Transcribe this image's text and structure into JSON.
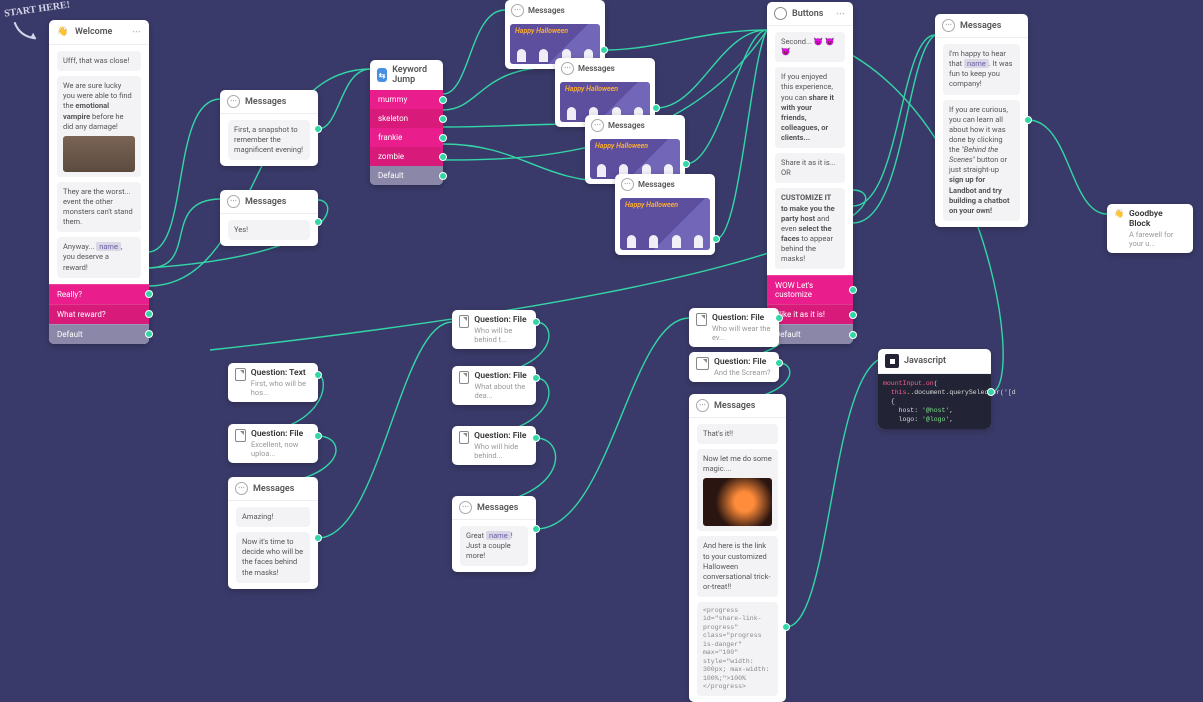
{
  "start_label": "START HERE!",
  "welcome": {
    "title": "Welcome",
    "msg1": "Ufff, that was close!",
    "msg2_head": "We are sure lucky you were able to find the ",
    "msg2_bold": "emotional vampire",
    "msg2_tail": " before he did any damage!",
    "msg3": "They are the worst... event the other monsters can't stand them.",
    "msg4_head": "Anyway... ",
    "msg4_var": "name",
    "msg4_tail": ", you deserve a reward!",
    "btn1": "Really?",
    "btn2": "What reward?",
    "default": "Default"
  },
  "msg_a": {
    "title": "Messages",
    "text": "First, a snapshot to remember the magnificent evening!"
  },
  "msg_b": {
    "title": "Messages",
    "text": "Yes!"
  },
  "keyword_jump": {
    "title": "Keyword Jump",
    "rows": [
      "mummy",
      "skeleton",
      "frankie",
      "zombie",
      "Default"
    ]
  },
  "halloween_banner": "Happy Halloween",
  "msg_h1": {
    "title": "Messages"
  },
  "msg_h2": {
    "title": "Messages"
  },
  "msg_h3": {
    "title": "Messages"
  },
  "msg_h4": {
    "title": "Messages"
  },
  "buttons": {
    "title": "Buttons",
    "line1": "Second...  😈  😈  😈",
    "line2_a": "If you enjoyed this experience, you can ",
    "line2_b": "share it with your friends, colleagues, or clients...",
    "line3": "Share it as it is... OR",
    "line4_a": "CUSTOMIZE IT to make you the party host",
    "line4_b": " and even ",
    "line4_c": "select the faces",
    "line4_d": " to appear behind the masks!",
    "btn1": "WOW Let's customize",
    "btn2": "I like it as it is!",
    "default": "Default"
  },
  "msg_right": {
    "title": "Messages",
    "p1_a": "I'm happy to hear that ",
    "p1_var": "name",
    "p1_b": ". It was fun to keep you company!",
    "p2_a": "If you are curious, you can learn all about how it was done by clicking the ",
    "p2_i": "\"Behind the Scenes\"",
    "p2_b": " button or just straight-up ",
    "p2_bold": "sign up for Landbot and try building a chatbot on your own!"
  },
  "goodbye": {
    "title": "Goodbye Block",
    "subtitle": "A farewell for your u..."
  },
  "q_text": {
    "title": "Question: Text",
    "subtitle": "First, who will be hos..."
  },
  "q_file1": {
    "title": "Question: File",
    "subtitle": "Excellent, now uploa..."
  },
  "q_file2": {
    "title": "Question: File",
    "subtitle": "Who will be behind t..."
  },
  "q_file3": {
    "title": "Question: File",
    "subtitle": "What about the dea..."
  },
  "q_file4": {
    "title": "Question: File",
    "subtitle": "Who will hide behind..."
  },
  "q_file5": {
    "title": "Question: File",
    "subtitle": "Who will wear the ev..."
  },
  "q_file6": {
    "title": "Question: File",
    "subtitle": "And the Scream?"
  },
  "msg_amazing": {
    "title": "Messages",
    "p1": "Amazing!",
    "p2": "Now it's time to decide who will be the faces behind the masks!"
  },
  "msg_great": {
    "title": "Messages",
    "p_a": "Great ",
    "p_var": "name",
    "p_b": "! Just a couple more!"
  },
  "msg_magic": {
    "title": "Messages",
    "p1": "That's it!!",
    "p2": "Now let me do some magic....",
    "p3": "And here is the link to your customized Halloween conversational trick-or-treat!!",
    "code": "<progress id=\"share-link-progress\" class=\"progress is-danger\" max=\"100\" style=\"width: 300px; max-width: 100%;\">100%</progress>"
  },
  "js": {
    "title": "Javascript",
    "l1a": "mountInput.on",
    "l1b": "(",
    "l2a": "this",
    "l2b": ".document.querySelector('[d",
    "l3": "{",
    "l4a": "host: ",
    "l4b": "'@host'",
    "l4c": ",",
    "l5a": "logo: ",
    "l5b": "'@logo'",
    "l5c": ","
  }
}
